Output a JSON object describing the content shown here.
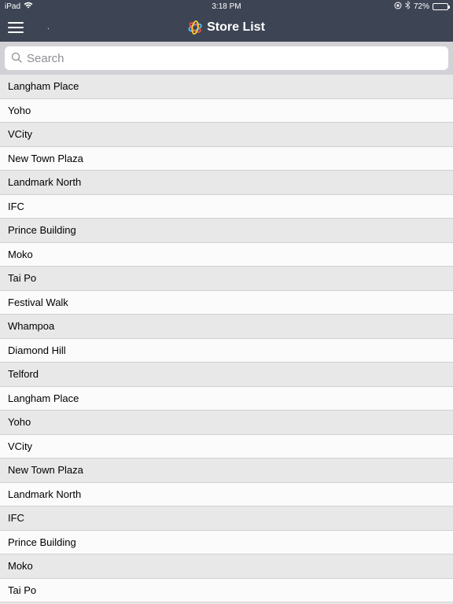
{
  "status": {
    "device": "iPad",
    "time": "3:18 PM",
    "battery": "72%"
  },
  "nav": {
    "title": "Store List"
  },
  "search": {
    "placeholder": "Search"
  },
  "stores": [
    "Langham Place",
    "Yoho",
    "VCity",
    "New Town Plaza",
    "Landmark North",
    "IFC",
    "Prince Building",
    "Moko",
    "Tai Po",
    "Festival Walk",
    "Whampoa",
    "Diamond Hill",
    "Telford",
    "Langham Place",
    "Yoho",
    "VCity",
    "New Town Plaza",
    "Landmark North",
    "IFC",
    "Prince Building",
    "Moko",
    "Tai Po"
  ]
}
